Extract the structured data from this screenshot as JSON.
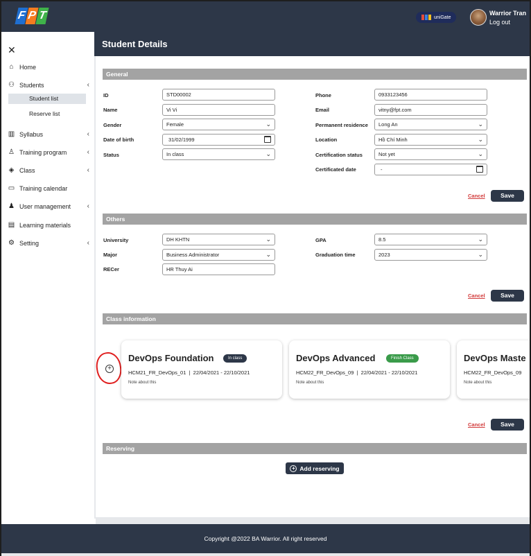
{
  "header": {
    "logo_letters": [
      "F",
      "P",
      "T"
    ],
    "unigate_label": "uniGate",
    "user_name": "Warrior Tran",
    "logout_label": "Log out"
  },
  "sidebar": {
    "close_icon": "close-icon",
    "items": [
      {
        "label": "Home",
        "icon": "home-icon"
      },
      {
        "label": "Students",
        "icon": "users-icon",
        "expanded": true
      },
      {
        "label": "Student list",
        "active": true
      },
      {
        "label": "Reserve list"
      },
      {
        "label": "Syllabus",
        "icon": "book-icon"
      },
      {
        "label": "Training program",
        "icon": "program-icon"
      },
      {
        "label": "Class",
        "icon": "class-icon"
      },
      {
        "label": "Training calendar",
        "icon": "calendar-icon"
      },
      {
        "label": "User management",
        "icon": "user-icon"
      },
      {
        "label": "Learning materials",
        "icon": "folder-icon"
      },
      {
        "label": "Setting",
        "icon": "gear-icon"
      }
    ]
  },
  "page": {
    "title": "Student Details"
  },
  "general": {
    "section_title": "General",
    "labels": {
      "id": "ID",
      "name": "Name",
      "gender": "Gender",
      "dob": "Date of birth",
      "status": "Status",
      "phone": "Phone",
      "email": "Email",
      "permanent_residence": "Permanent residence",
      "location": "Location",
      "certification_status": "Certification status",
      "certificated_date": "Certificated date"
    },
    "values": {
      "id": "STD00002",
      "name": "Vi Vi",
      "gender": "Female",
      "dob": "31/02/1999",
      "status": "In class",
      "phone": "0933123456",
      "email": "vitny@fpt.com",
      "permanent_residence": "Long An",
      "location": "Hồ Chí Minh",
      "certification_status": "Not yet",
      "certificated_date": "-"
    }
  },
  "others": {
    "section_title": "Others",
    "labels": {
      "university": "University",
      "major": "Major",
      "recer": "RECer",
      "gpa": "GPA",
      "graduation_time": "Graduation time"
    },
    "values": {
      "university": "DH KHTN",
      "major": "Business Administrator",
      "recer": "HR Thuy Ai",
      "gpa": "8.5",
      "graduation_time": "2023"
    }
  },
  "class_info": {
    "section_title": "Class information",
    "cards": [
      {
        "name": "DevOps Foundation",
        "badge": "In class",
        "badge_color": "#2d3748",
        "code": "HCM21_FR_DevOps_01",
        "dates": "22/04/2021 - 22/10/2021",
        "note": "Note about this"
      },
      {
        "name": "DevOps Advanced",
        "badge": "Finish Class",
        "badge_color": "#3a9b4a",
        "code": "HCM22_FR_DevOps_09",
        "dates": "22/04/2021 - 22/10/2021",
        "note": "Note about this"
      },
      {
        "name": "DevOps Maste",
        "badge": "",
        "badge_color": "",
        "code": "HCM22_FR_DevOps_09",
        "dates": "",
        "note": "Note about this"
      }
    ]
  },
  "reserving": {
    "section_title": "Reserving",
    "add_label": "Add reserving"
  },
  "actions": {
    "cancel_label": "Cancel",
    "save_label": "Save"
  },
  "footer": {
    "copyright": "Copyright @2022 BA Warrior. All right reserved"
  },
  "colors": {
    "header_bg": "#2d3748",
    "section_bg": "#a3a3a3",
    "cancel": "#d23b3b",
    "in_class_badge": "#2d3748",
    "finish_badge": "#3a9b4a",
    "annotation": "#e01f1f"
  }
}
